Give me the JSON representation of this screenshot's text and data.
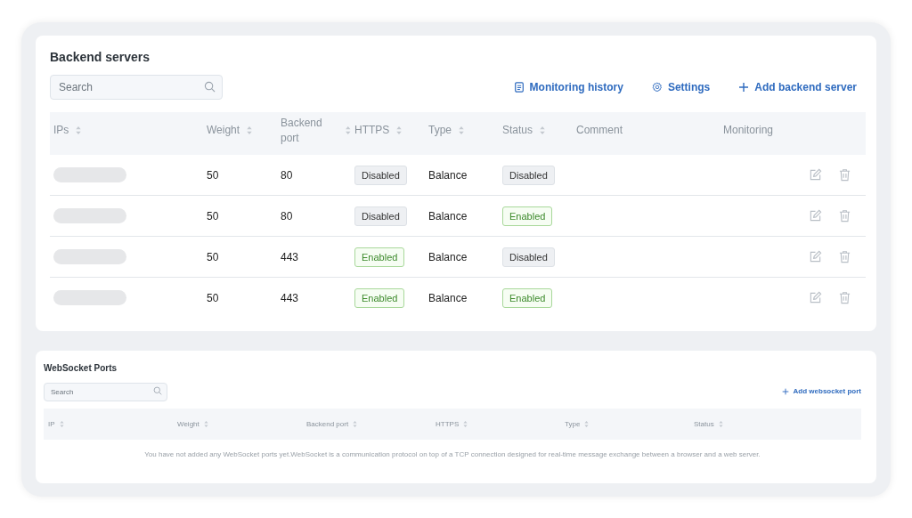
{
  "backend_servers": {
    "title": "Backend servers",
    "search": {
      "placeholder": "Search"
    },
    "actions": [
      {
        "label": "Monitoring history",
        "kind": "history"
      },
      {
        "label": "Settings",
        "kind": "settings"
      },
      {
        "label": "Add backend server",
        "kind": "add"
      }
    ],
    "columns": [
      {
        "label": "IPs",
        "sortable": true
      },
      {
        "label": "Weight",
        "sortable": true
      },
      {
        "label": "Backend port",
        "sortable": true
      },
      {
        "label": "HTTPS",
        "sortable": true
      },
      {
        "label": "Type",
        "sortable": true
      },
      {
        "label": "Status",
        "sortable": true
      },
      {
        "label": "Comment",
        "sortable": false
      },
      {
        "label": "Monitoring",
        "sortable": false
      }
    ],
    "rows": [
      {
        "weight": "50",
        "port": "80",
        "https": {
          "text": "Disabled",
          "enabled": false
        },
        "type": "Balance",
        "status": {
          "text": "Disabled",
          "enabled": false
        }
      },
      {
        "weight": "50",
        "port": "80",
        "https": {
          "text": "Disabled",
          "enabled": false
        },
        "type": "Balance",
        "status": {
          "text": "Enabled",
          "enabled": true
        }
      },
      {
        "weight": "50",
        "port": "443",
        "https": {
          "text": "Enabled",
          "enabled": true
        },
        "type": "Balance",
        "status": {
          "text": "Disabled",
          "enabled": false
        }
      },
      {
        "weight": "50",
        "port": "443",
        "https": {
          "text": "Enabled",
          "enabled": true
        },
        "type": "Balance",
        "status": {
          "text": "Enabled",
          "enabled": true
        }
      }
    ]
  },
  "websocket_ports": {
    "title": "WebSocket Ports",
    "search": {
      "placeholder": "Search"
    },
    "add_button": "Add websocket port",
    "columns": [
      {
        "label": "IP",
        "sortable": true
      },
      {
        "label": "Weight",
        "sortable": true
      },
      {
        "label": "Backend port",
        "sortable": true
      },
      {
        "label": "HTTPS",
        "sortable": true
      },
      {
        "label": "Type",
        "sortable": true
      },
      {
        "label": "Status",
        "sortable": true
      }
    ],
    "empty_message": "You have not added any WebSocket ports yet.WebSocket is a communication protocol on top of a TCP connection designed for real-time message exchange between a browser and a web server."
  }
}
